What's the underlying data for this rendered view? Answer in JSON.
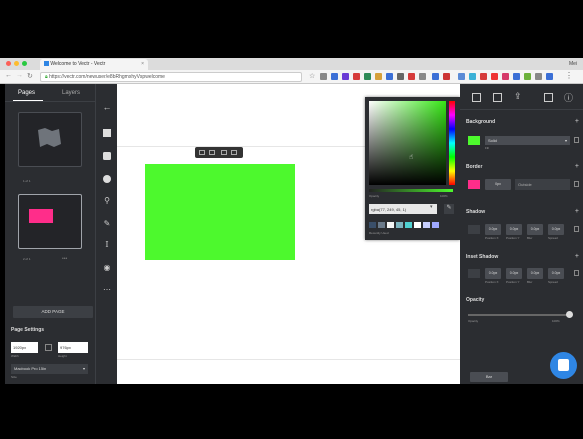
{
  "browser": {
    "tab_title": "Welcome to Vectr - Vectr",
    "url": "https://vectr.com/newuser/e8bRhgmxhyVspwelcome",
    "user": "Mei"
  },
  "left_panel": {
    "tab_pages": "Pages",
    "tab_layers": "Layers",
    "page1_label": "1 of 1",
    "page2_label": "2 of 1",
    "add_page": "ADD PAGE",
    "page_settings": "Page Settings",
    "width_value": "1920px",
    "height_value": "976px",
    "width_label": "Width",
    "height_label": "Height",
    "preset": "Macbook Pro 15in",
    "preset_caption": "Size"
  },
  "right_panel": {
    "background": "Background",
    "fill_type": "Solid",
    "fill_caption": "Fill",
    "border": "Border",
    "border_width": "0px",
    "border_style": "Outside",
    "shadow": "Shadow",
    "inset_shadow": "Inset Shadow",
    "opacity": "Opacity",
    "opacity_label": "Opacity",
    "opacity_value": "100%",
    "shadow_values": [
      "0.0px",
      "0.0px",
      "0.0px",
      "0.0px"
    ],
    "shadow_captions": [
      "Position X",
      "Position Y",
      "Blur",
      "Spread"
    ],
    "bottom_button": "Bar"
  },
  "color_picker": {
    "hex": "rgba(77, 249, 45, 1)",
    "opacity_label": "Opacity",
    "opacity_value": "100%",
    "recent_label": "Recently Used",
    "recent_colors": [
      "#3a4f6a",
      "#6b7a8a",
      "#f5f5f5",
      "#7db4c0",
      "#4fd1d1",
      "#ffffff",
      "#c8d0ff",
      "#9fa8ff"
    ]
  },
  "colors": {
    "green_rect": "#4df92d",
    "accent_pink": "#ff2d8a",
    "help_blue": "#2f86e4"
  }
}
